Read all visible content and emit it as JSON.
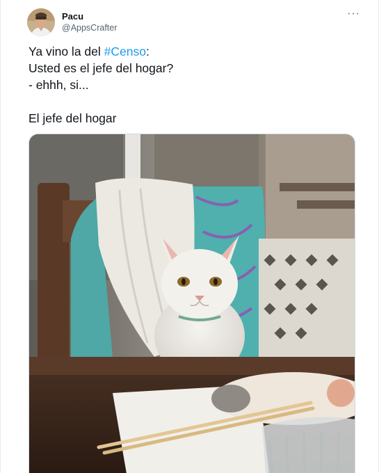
{
  "author": {
    "display_name": "Pacu",
    "handle": "@AppsCrafter",
    "avatar_icon": "user-avatar"
  },
  "menu": {
    "more_label": "···",
    "more_icon": "more-options-icon"
  },
  "tweet": {
    "text_before_hashtag": "Ya vino la del ",
    "hashtag": "#Censo",
    "text_after_hashtag": ":\nUsted es el jefe del hogar?\n- ehhh, si...\n\nEl jefe del hogar"
  },
  "colors": {
    "hashtag": "#1d9bf0",
    "text": "#0f1419",
    "secondary": "#536471"
  }
}
